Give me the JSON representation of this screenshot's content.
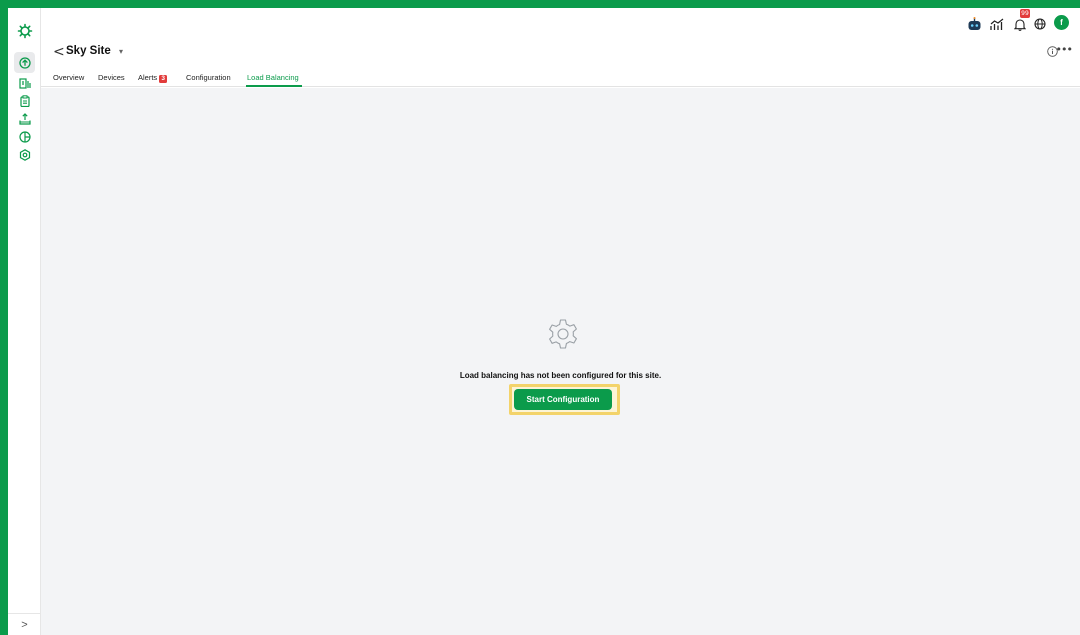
{
  "header": {
    "notification_count": "99"
  },
  "user": {
    "avatar_initial": "f"
  },
  "site": {
    "back_label": "<",
    "title": "Sky Site",
    "dropdown_icon": "caret-down-icon"
  },
  "tabs": [
    {
      "label": "Overview"
    },
    {
      "label": "Devices"
    },
    {
      "label": "Alerts",
      "badge": "3"
    },
    {
      "label": "Configuration"
    },
    {
      "label": "Load Balancing",
      "active": true
    }
  ],
  "main": {
    "empty_icon": "gear-outline-icon",
    "message": "Load balancing has not been configured for this site.",
    "start_button_label": "Start Configuration"
  },
  "sidebar": {
    "collapse_label": ">"
  },
  "colors": {
    "brand_green": "#0b9b4b",
    "alert_red": "#e23b3b",
    "highlight_yellow": "#f3d36a",
    "content_bg": "#f3f4f6"
  }
}
